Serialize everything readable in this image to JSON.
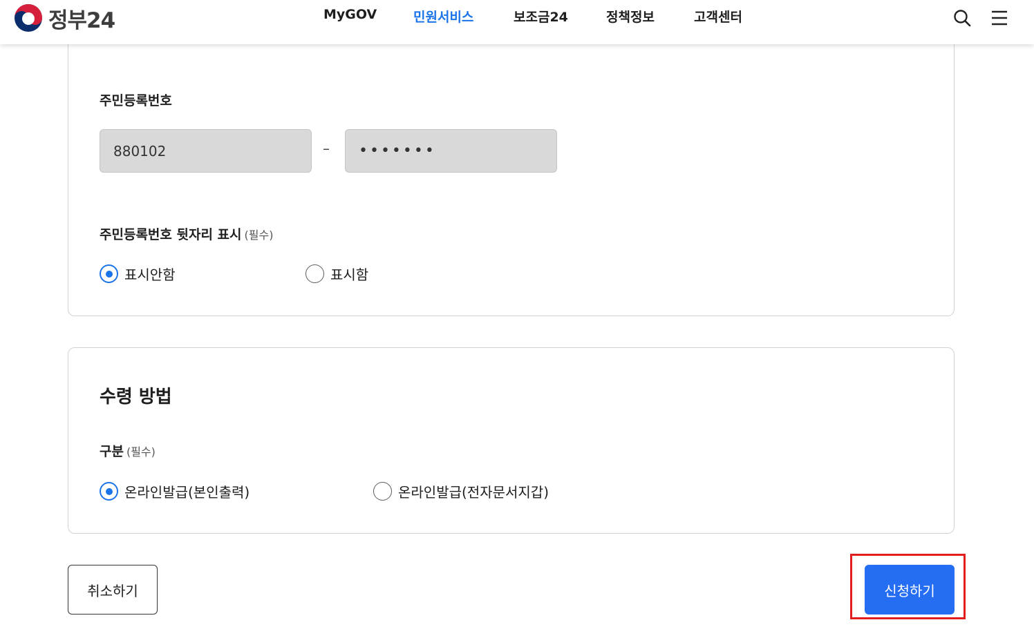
{
  "header": {
    "logo_text": "정부24",
    "nav": [
      {
        "label": "MyGOV",
        "active": false
      },
      {
        "label": "민원서비스",
        "active": true
      },
      {
        "label": "보조금24",
        "active": false
      },
      {
        "label": "정책정보",
        "active": false
      },
      {
        "label": "고객센터",
        "active": false
      }
    ],
    "icons": [
      "search-icon",
      "hamburger-menu-icon"
    ]
  },
  "resident_section": {
    "label": "주민등록번호",
    "front_value": "880102",
    "separator": "–",
    "back_value": "•••••••",
    "display_label": "주민등록번호 뒷자리 표시",
    "display_required": "(필수)",
    "display_options": [
      {
        "label": "표시안함",
        "checked": true
      },
      {
        "label": "표시함",
        "checked": false
      }
    ]
  },
  "receipt_section": {
    "title": "수령 방법",
    "type_label": "구분",
    "type_required": "(필수)",
    "type_options": [
      {
        "label": "온라인발급(본인출력)",
        "checked": true
      },
      {
        "label": "온라인발급(전자문서지갑)",
        "checked": false
      }
    ]
  },
  "actions": {
    "cancel_label": "취소하기",
    "submit_label": "신청하기"
  },
  "colors": {
    "accent": "#256ef4",
    "active_nav": "#1a73e8",
    "highlight": "#e11d1d"
  }
}
